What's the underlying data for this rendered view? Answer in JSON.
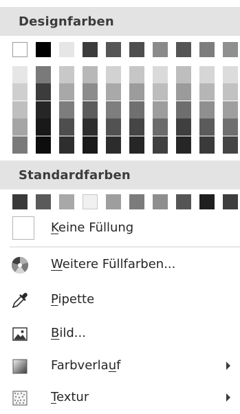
{
  "theme_colors": {
    "title": "Designfarben",
    "top_row": [
      "#ffffff",
      "#000000",
      "#e6e6e6",
      "#3c3c3c",
      "#555555",
      "#4e4e4e",
      "#8a8a8a",
      "#555555",
      "#7d7d7d",
      "#8f8f8f"
    ],
    "columns": [
      [
        "#e6e6e6",
        "#cfcfcf",
        "#bfbfbf",
        "#a5a5a5",
        "#7a7a7a"
      ],
      [
        "#7a7a7a",
        "#3c3c3c",
        "#262626",
        "#191919",
        "#0d0d0d"
      ],
      [
        "#c8c8c8",
        "#a8a8a8",
        "#7d7d7d",
        "#4e4e4e",
        "#2e2e2e"
      ],
      [
        "#b8b8b8",
        "#8c8c8c",
        "#5c5c5c",
        "#2e2e2e",
        "#1a1a1a"
      ],
      [
        "#d2d2d2",
        "#a9a9a9",
        "#7e7e7e",
        "#525252",
        "#2c2c2c"
      ],
      [
        "#c6c6c6",
        "#9c9c9c",
        "#707070",
        "#454545",
        "#262626"
      ],
      [
        "#dadada",
        "#bdbdbd",
        "#9d9d9d",
        "#6b6b6b",
        "#404040"
      ],
      [
        "#bebebe",
        "#9b9b9b",
        "#6e6e6e",
        "#3f3f3f",
        "#262626"
      ],
      [
        "#d6d6d6",
        "#b6b6b6",
        "#8f8f8f",
        "#5b5b5b",
        "#3a3a3a"
      ],
      [
        "#dcdcdc",
        "#c2c2c2",
        "#9f9f9f",
        "#6f6f6f",
        "#454545"
      ]
    ]
  },
  "standard_colors": {
    "title": "Standardfarben",
    "swatches": [
      "#3a3a3a",
      "#5a5a5a",
      "#a8a8a8",
      "#f0f0f0",
      "#9e9e9e",
      "#7c7c7c",
      "#8e8e8e",
      "#555555",
      "#1f1f1f",
      "#3e3e3e"
    ]
  },
  "no_fill": {
    "label_underlined": "K",
    "label_rest": "eine Füllung"
  },
  "menu_items": [
    {
      "icon": "color-wheel-icon",
      "label_underlined": "W",
      "label_rest": "eitere Füllfarben...",
      "label_before": ""
    },
    {
      "icon": "eyedropper-icon",
      "label_underlined": "P",
      "label_rest": "ipette",
      "label_before": ""
    },
    {
      "icon": "picture-icon",
      "label_underlined": "B",
      "label_rest": "ild...",
      "label_before": ""
    },
    {
      "icon": "gradient-icon",
      "label_before": "Farbverla",
      "label_underlined": "u",
      "label_rest": "f",
      "has_submenu": true
    },
    {
      "icon": "texture-icon",
      "label_underlined": "T",
      "label_rest": "extur",
      "label_before": "",
      "has_submenu": true
    }
  ]
}
